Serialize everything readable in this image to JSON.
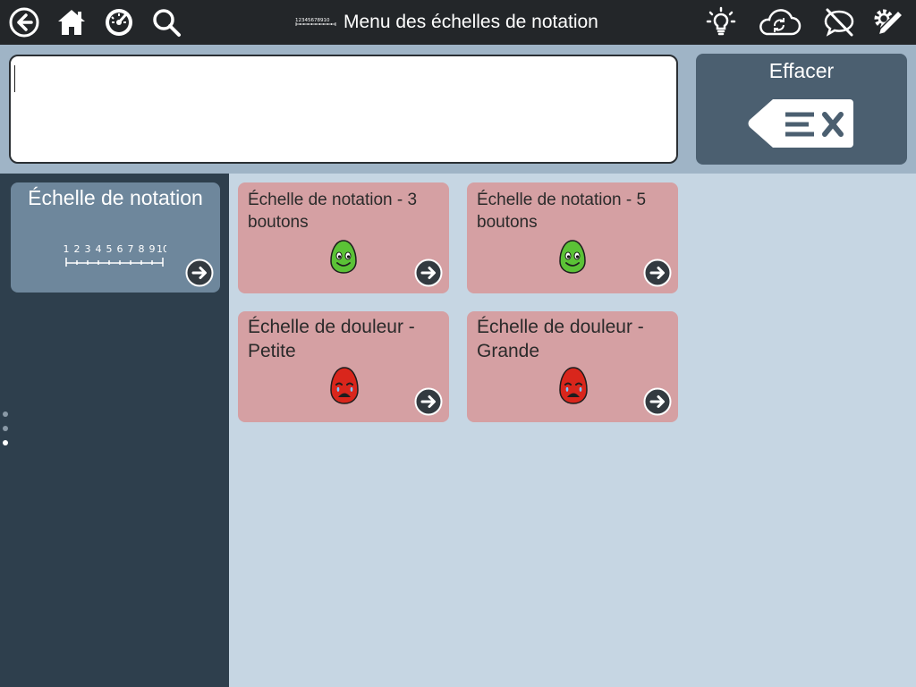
{
  "header": {
    "title": "Menu des échelles de notation",
    "title_scale_digits": "12345678910"
  },
  "message_bar": {
    "text": "",
    "clear_label": "Effacer"
  },
  "left_panel": {
    "card_title": "Échelle de notation",
    "scale_numbers": [
      "1",
      "2",
      "3",
      "4",
      "5",
      "6",
      "7",
      "8",
      "9",
      "10"
    ],
    "page_count": 3,
    "active_page": 3
  },
  "cards": [
    {
      "title": "Échelle de notation - 3 boutons",
      "icon": "happy-face-icon"
    },
    {
      "title": "Échelle de notation - 5 boutons",
      "icon": "happy-face-icon"
    },
    {
      "title": "Échelle de douleur - Petite",
      "icon": "crying-face-icon"
    },
    {
      "title": "Échelle de douleur - Grande",
      "icon": "crying-face-icon"
    }
  ],
  "colors": {
    "toolbar": "#232629",
    "message_bar": "#9fb4c6",
    "clear_button": "#4b5f70",
    "left_panel": "#2e3f4d",
    "folder_card": "#6e879c",
    "item_card": "#d5a0a3",
    "content_bg": "#c6d6e3",
    "happy_face": "#5bc236",
    "crying_face": "#d9261c"
  }
}
